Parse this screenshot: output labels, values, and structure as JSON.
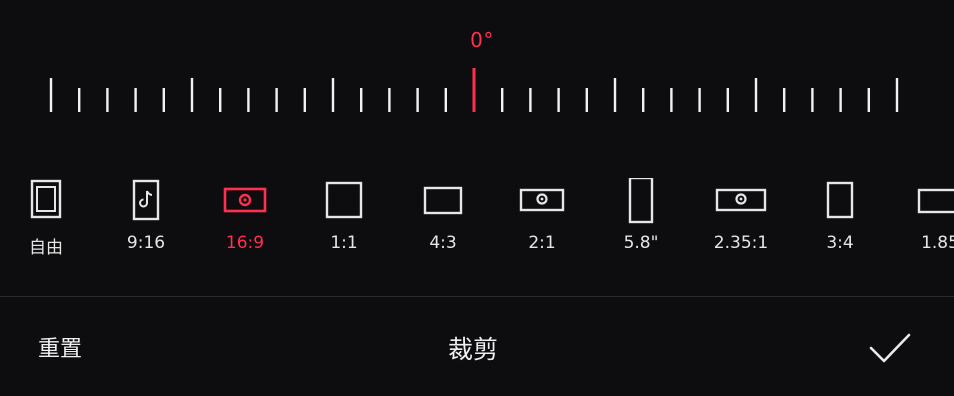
{
  "rotation": {
    "angle_label": "0°",
    "accent_color": "#ff2f4f"
  },
  "ratios": [
    {
      "label": "自由",
      "icon": "free-crop-icon",
      "active": false
    },
    {
      "label": "9:16",
      "icon": "tiktok-portrait-icon",
      "active": false
    },
    {
      "label": "16:9",
      "icon": "landscape-video-icon",
      "active": true
    },
    {
      "label": "1:1",
      "icon": "square-icon",
      "active": false
    },
    {
      "label": "4:3",
      "icon": "rectangle-4-3-icon",
      "active": false
    },
    {
      "label": "2:1",
      "icon": "landscape-video-2-1-icon",
      "active": false
    },
    {
      "label": "5.8\"",
      "icon": "phone-portrait-icon",
      "active": false
    },
    {
      "label": "2.35:1",
      "icon": "cinema-wide-icon",
      "active": false
    },
    {
      "label": "3:4",
      "icon": "portrait-3-4-icon",
      "active": false
    },
    {
      "label": "1.85",
      "icon": "wide-rectangle-icon",
      "active": false
    }
  ],
  "footer": {
    "reset_label": "重置",
    "title": "裁剪",
    "confirm_icon": "checkmark-icon"
  }
}
